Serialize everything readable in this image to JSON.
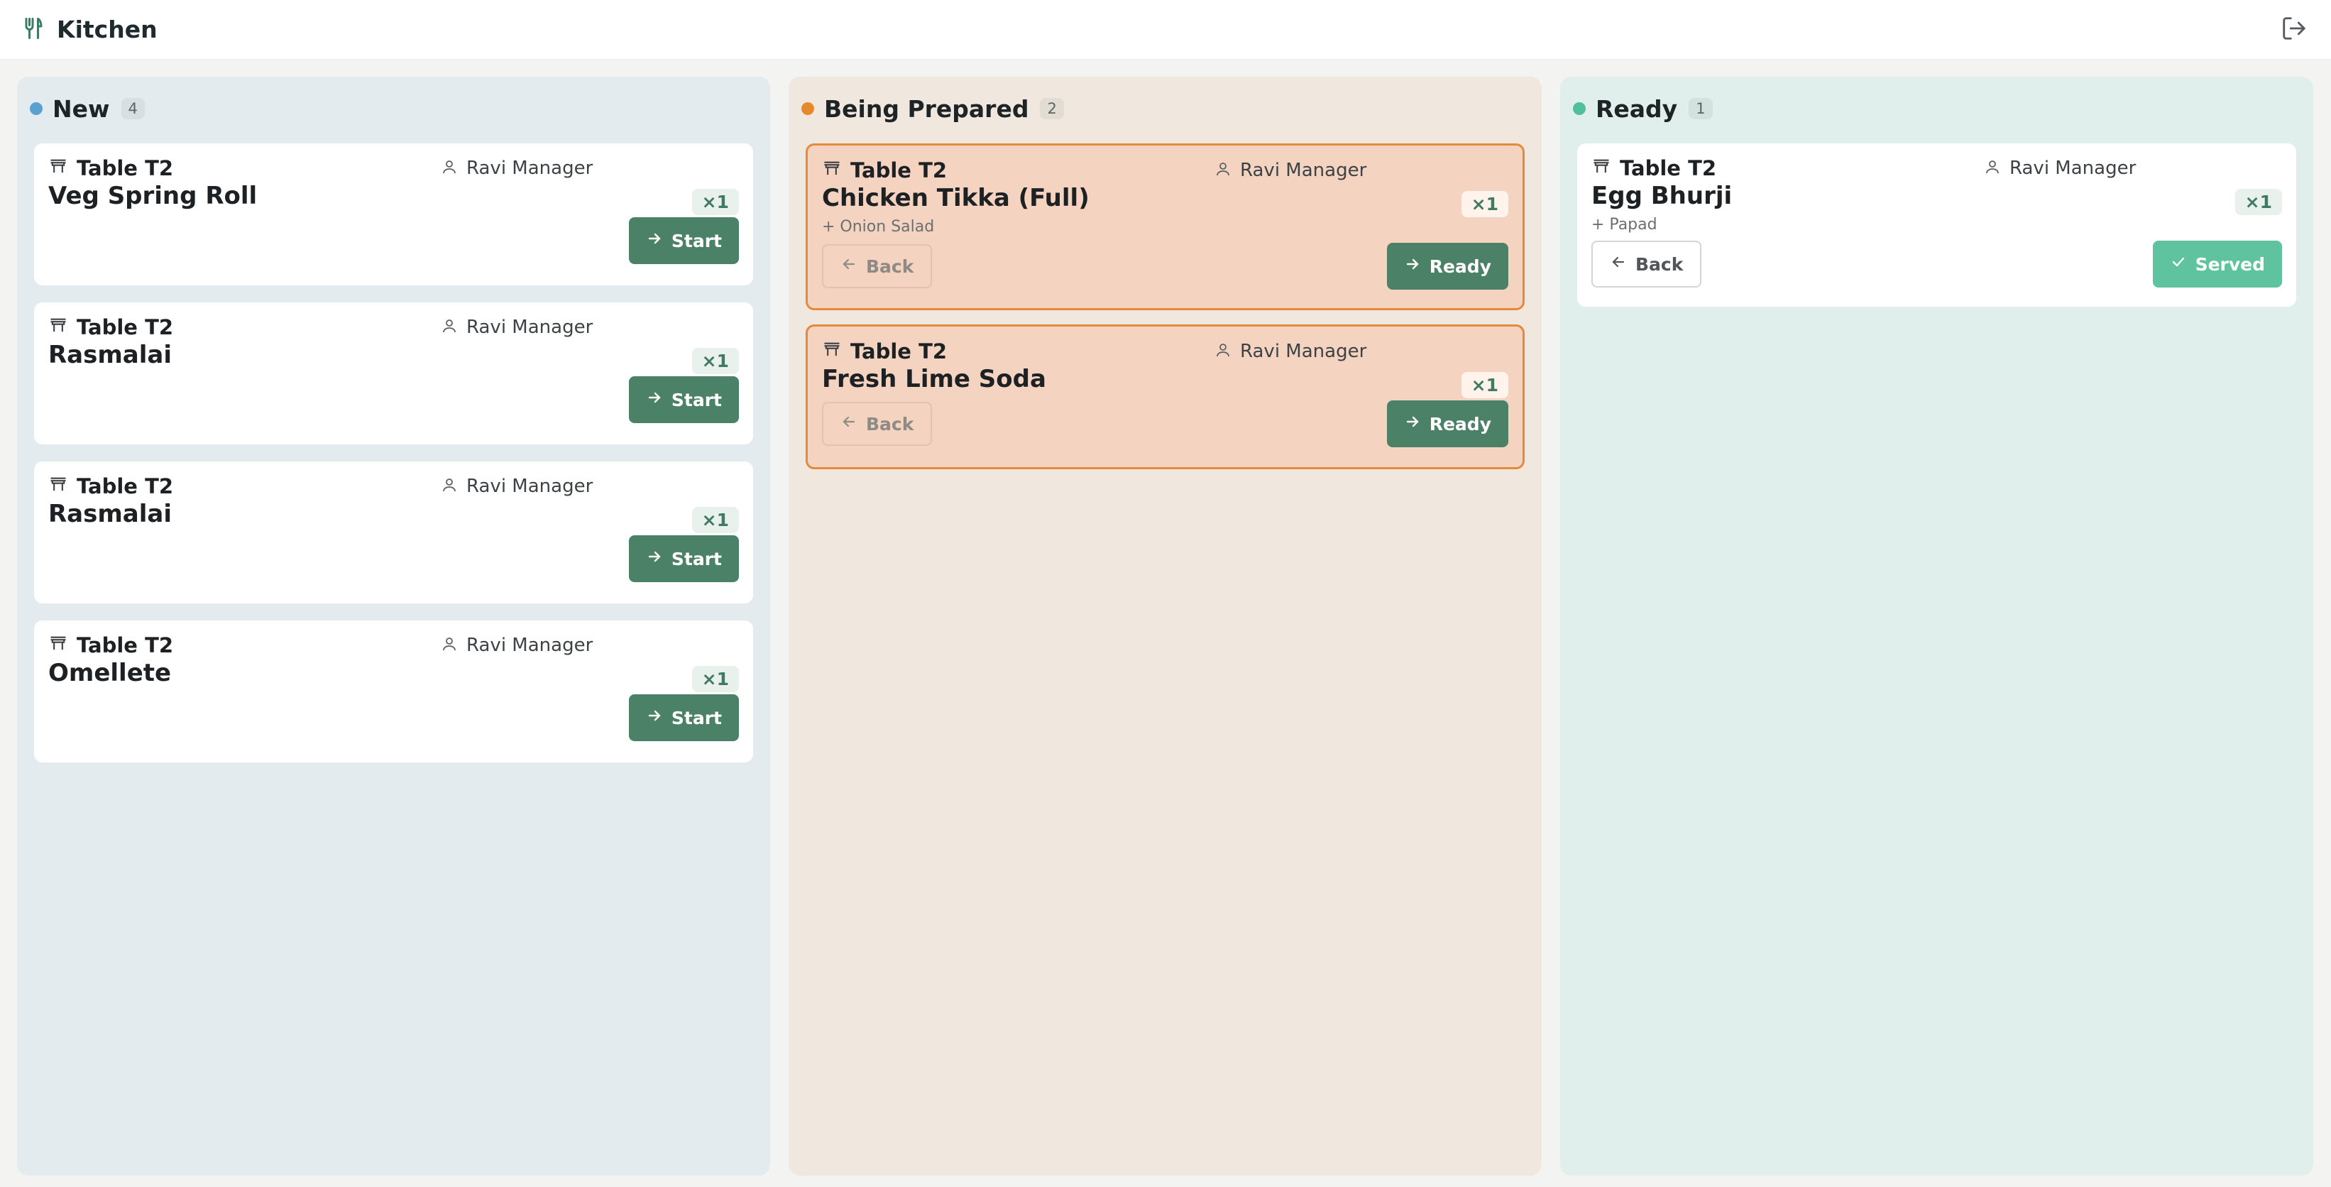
{
  "app": {
    "title": "Kitchen"
  },
  "colors": {
    "new": "#5aa1cf",
    "prep": "#e58a2c",
    "ready": "#4fc09b",
    "accent": "#4b8167"
  },
  "columns": {
    "new": {
      "title": "New",
      "count": "4",
      "cards": [
        {
          "table": "Table T2",
          "staff": "Ravi Manager",
          "item": "Veg Spring Roll",
          "qty": "×1",
          "action": "Start"
        },
        {
          "table": "Table T2",
          "staff": "Ravi Manager",
          "item": "Rasmalai",
          "qty": "×1",
          "action": "Start"
        },
        {
          "table": "Table T2",
          "staff": "Ravi Manager",
          "item": "Rasmalai",
          "qty": "×1",
          "action": "Start"
        },
        {
          "table": "Table T2",
          "staff": "Ravi Manager",
          "item": "Omellete",
          "qty": "×1",
          "action": "Start"
        }
      ]
    },
    "prep": {
      "title": "Being Prepared",
      "count": "2",
      "cards": [
        {
          "table": "Table T2",
          "staff": "Ravi Manager",
          "item": "Chicken Tikka (Full)",
          "modifier": "+ Onion Salad",
          "qty": "×1",
          "back": "Back",
          "action": "Ready"
        },
        {
          "table": "Table T2",
          "staff": "Ravi Manager",
          "item": "Fresh Lime Soda",
          "qty": "×1",
          "back": "Back",
          "action": "Ready"
        }
      ]
    },
    "ready": {
      "title": "Ready",
      "count": "1",
      "cards": [
        {
          "table": "Table T2",
          "staff": "Ravi Manager",
          "item": "Egg Bhurji",
          "modifier": "+ Papad",
          "qty": "×1",
          "back": "Back",
          "action": "Served"
        }
      ]
    }
  },
  "icons": {
    "brand": "chef-utensils-icon",
    "logout": "logout-icon",
    "table": "table-icon",
    "staff": "user-icon",
    "forward": "arrow-right-icon",
    "backward": "arrow-left-icon",
    "served": "check-icon"
  }
}
